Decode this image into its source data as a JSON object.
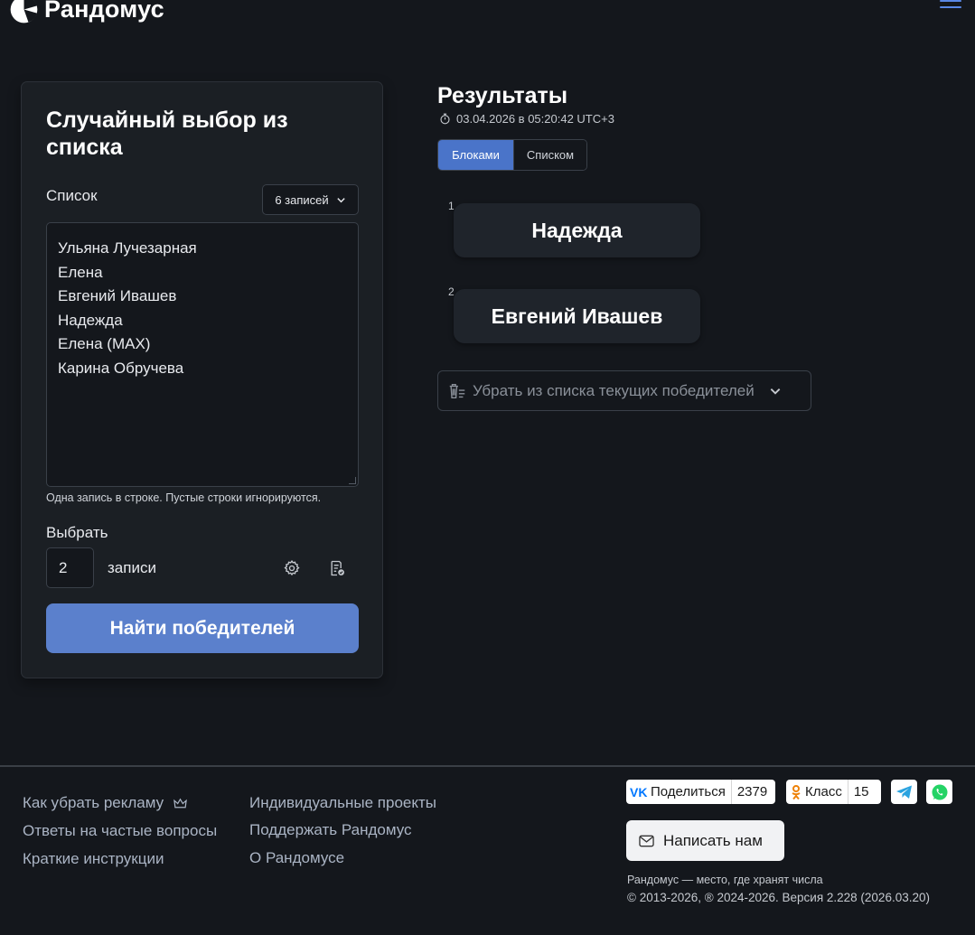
{
  "header": {
    "logo_text": "Рандомус",
    "menu_icon": "hamburger-icon"
  },
  "form": {
    "title": "Случайный выбор из списка",
    "list_label": "Список",
    "count_dropdown": "6 записей",
    "list_items": [
      "Ульяна Лучезарная",
      "Елена",
      "Евгений Ивашев",
      "Надежда",
      "Елена (MAX)",
      "Карина Обручева"
    ],
    "hint": "Одна запись в строке. Пустые строки игнорируются.",
    "choose_label": "Выбрать",
    "choose_value": "2",
    "choose_suffix": "записи",
    "settings_icon": "gear-icon",
    "checklist_icon": "checklist-icon",
    "submit_label": "Найти победителей",
    "accent": "#5b80cc"
  },
  "results": {
    "title": "Результаты",
    "timestamp": "03.04.2026 в 05:20:42 UTC+3",
    "view_tabs": [
      {
        "label": "Блоками",
        "active": true
      },
      {
        "label": "Списком",
        "active": false
      }
    ],
    "winners": [
      {
        "index": "1",
        "name": "Надежда"
      },
      {
        "index": "2",
        "name": "Евгений Ивашев"
      }
    ],
    "remove_label": "Убрать из списка текущих победителей"
  },
  "footer": {
    "links_col1": [
      "Как убрать рекламу",
      "Ответы на частые вопросы",
      "Краткие инструкции"
    ],
    "links_col2": [
      "Индивидуальные проекты",
      "Поддержать Рандомус",
      "О Рандомусе"
    ],
    "vk_share_label": "Поделиться",
    "vk_share_count": "2379",
    "ok_share_label": "Класс",
    "ok_share_count": "15",
    "contact_label": "Написать нам",
    "tagline": "Рандомус — место, где хранят числа",
    "copyright": "© 2013-2026, ® 2024-2026. Версия 2.228 (2026.03.20)"
  }
}
